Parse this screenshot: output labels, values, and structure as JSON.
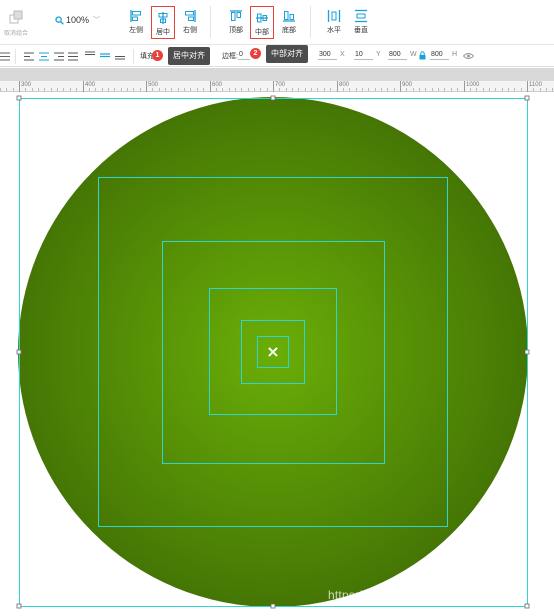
{
  "toolbar": {
    "ungroup_label": "取消组合",
    "zoom_value": "100%",
    "align_left_label": "左侧",
    "align_center_label": "居中",
    "align_right_label": "右侧",
    "align_top_label": "顶部",
    "align_middle_label": "中部",
    "align_bottom_label": "底部",
    "distribute_h_label": "水平",
    "distribute_v_label": "垂直"
  },
  "propbar": {
    "fill_label": "填充",
    "border_label": "边框:",
    "border_value": "0",
    "x_value": "300",
    "x_label": "X",
    "y_value": "10",
    "y_label": "Y",
    "w_value": "800",
    "w_label": "W",
    "h_value": "800",
    "h_label": "H"
  },
  "annotations": {
    "badge_1": "1",
    "badge_2": "2",
    "tooltip_center": "居中对齐",
    "tooltip_middle": "中部对齐"
  },
  "ruler": {
    "labels": [
      "300",
      "400",
      "500",
      "600",
      "700",
      "800",
      "900",
      "1000",
      "1100"
    ]
  },
  "canvas": {
    "gradient_center_color": "#6aae08",
    "gradient_edge_color": "#457605",
    "guide_color": "#2fd6d0",
    "center_marker": "×"
  },
  "watermark": "https://blog.csdn.net/congzi580",
  "colors": {
    "accent": "#1ba0d8",
    "highlight_red": "#e8413a"
  }
}
